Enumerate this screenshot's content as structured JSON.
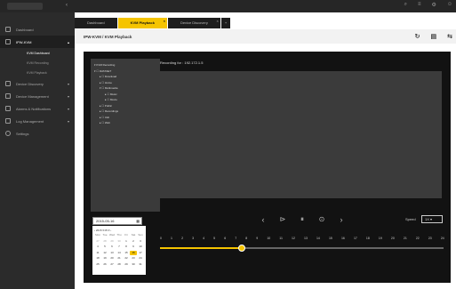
{
  "colors": {
    "accent": "#f5c400",
    "sidebar": "#2b2b2b",
    "panel": "#121212"
  },
  "tabs": [
    {
      "label": "Dashboard"
    },
    {
      "label": "KVM Playback"
    },
    {
      "label": "Device Discovery"
    }
  ],
  "sidebar": {
    "items": [
      {
        "label": "Dashboard",
        "icon": "dashboard-icon"
      },
      {
        "label": "IPW-KVM",
        "icon": "monitor-icon"
      },
      {
        "label": "KVM Dashboard"
      },
      {
        "label": "KVM Recording"
      },
      {
        "label": "KVM Playback"
      },
      {
        "label": "Device Discovery",
        "icon": "discovery-icon"
      },
      {
        "label": "Device Management",
        "icon": "devices-icon"
      },
      {
        "label": "Alarms & Notifications",
        "icon": "alarm-icon"
      },
      {
        "label": "Log Management",
        "icon": "log-icon"
      },
      {
        "label": "Settings",
        "icon": "gear-icon"
      }
    ]
  },
  "page": {
    "breadcrumb": "IPW-KVM / KVM Playback"
  },
  "tree": [
    {
      "label": "▾ KVM Recording"
    },
    {
      "label": "▾ ☐ DATASET"
    },
    {
      "label": "▸ ☐ Download"
    },
    {
      "label": "▸ ☐ Home"
    },
    {
      "label": "▾ ☐ Multimedia"
    },
    {
      "label": "▸ ☐ Music"
    },
    {
      "label": "▸ ☐ Movie"
    },
    {
      "label": "▸ ☐ Public"
    },
    {
      "label": "▸ ☐ Recordings"
    },
    {
      "label": "▸ ☐ Usb"
    },
    {
      "label": "▸ ☐ Web"
    }
  ],
  "recording": {
    "label": "Recording for : 192.172.1.5"
  },
  "player": {
    "speed_label": "Speed",
    "speed_value": "1X ▾",
    "progress_hour": 6.9
  },
  "timeline": {
    "hours": [
      "0",
      "1",
      "2",
      "3",
      "4",
      "5",
      "6",
      "7",
      "8",
      "9",
      "10",
      "11",
      "12",
      "13",
      "14",
      "15",
      "16",
      "17",
      "18",
      "19",
      "20",
      "21",
      "22",
      "23",
      "24"
    ]
  },
  "date": {
    "value": "2015-05-16"
  },
  "calendar": {
    "month_nav": "‹ 2015 ▾ 05 ▾ ›",
    "weekdays": [
      "Mon",
      "Tue",
      "Wed",
      "Thu",
      "Fri",
      "Sat",
      "Sun"
    ],
    "days": [
      "27",
      "28",
      "29",
      "30",
      "1",
      "2",
      "3",
      "4",
      "5",
      "6",
      "7",
      "8",
      "9",
      "10",
      "11",
      "12",
      "13",
      "14",
      "15",
      "16",
      "17",
      "18",
      "19",
      "20",
      "21",
      "22",
      "23",
      "24",
      "25",
      "26",
      "27",
      "28",
      "29",
      "30",
      "31"
    ],
    "selected": "16"
  }
}
